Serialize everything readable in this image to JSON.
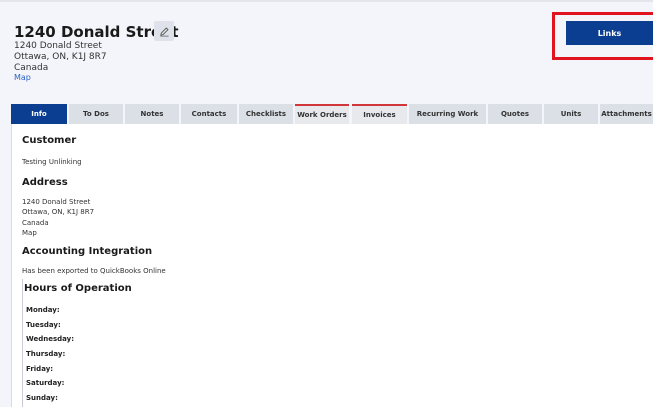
{
  "header": {
    "title": "1240 Donald Street",
    "address_lines": [
      "1240 Donald Street",
      "Ottawa, ON, K1J 8R7",
      "Canada"
    ],
    "map_link": "Map",
    "links_button": "Links"
  },
  "tabs": [
    {
      "label": "Info",
      "active": true
    },
    {
      "label": "To Dos"
    },
    {
      "label": "Notes"
    },
    {
      "label": "Contacts"
    },
    {
      "label": "Checklists"
    },
    {
      "label": "Work Orders"
    },
    {
      "label": "Invoices"
    },
    {
      "label": "Recurring Work"
    },
    {
      "label": "Quotes"
    },
    {
      "label": "Units"
    },
    {
      "label": "Attachments"
    }
  ],
  "info": {
    "customer_heading": "Customer",
    "customer_name": "Testing Unlinking",
    "address_heading": "Address",
    "address_lines": [
      "1240 Donald Street",
      "Ottawa, ON, K1J 8R7",
      "Canada"
    ],
    "map_link": "Map",
    "accounting_heading": "Accounting Integration",
    "accounting_status": "Has been exported to QuickBooks Online",
    "hours_heading": "Hours of Operation",
    "days": [
      "Monday:",
      "Tuesday:",
      "Wednesday:",
      "Thursday:",
      "Friday:",
      "Saturday:",
      "Sunday:"
    ]
  }
}
